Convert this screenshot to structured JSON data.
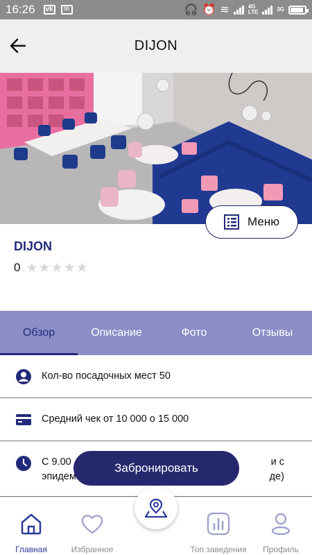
{
  "status_bar": {
    "time": "16:26",
    "network_label_1": "4G",
    "network_label_2": "LTE",
    "network_label_3": "3G"
  },
  "header": {
    "title": "DIJON"
  },
  "hero": {
    "menu_button_label": "Меню"
  },
  "place": {
    "name": "DIJON",
    "rating": "0",
    "stars_filled_fraction": 0
  },
  "tabs": [
    {
      "label": "Обзор",
      "active": true
    },
    {
      "label": "Описание",
      "active": false
    },
    {
      "label": "Фото",
      "active": false
    },
    {
      "label": "Отзывы",
      "active": false
    }
  ],
  "info": {
    "seats": "Кол-во посадочных мест  50",
    "avg_check": "Средний чек от 10 000 о 15 000",
    "hours_line1": "С 9.00",
    "hours_line1_end": "и с",
    "hours_line2": "эпидем",
    "hours_line2_end": "де)"
  },
  "book_button": {
    "label": "Забронировать"
  },
  "bottom_nav": {
    "items": [
      {
        "label": "Главная",
        "icon": "home-icon",
        "active": true
      },
      {
        "label": "Избранное",
        "icon": "heart-icon",
        "active": false
      },
      {
        "label": "Топ заведения",
        "icon": "chart-icon",
        "active": false
      },
      {
        "label": "Профиль",
        "icon": "profile-icon",
        "active": false
      }
    ],
    "map_label": "..."
  },
  "colors": {
    "brand_dark": "#23297a",
    "tab_bar": "#8b8ec6",
    "header_bg": "#efeff1",
    "status_bar": "#8c8c8c",
    "star_inactive": "#d8d8d8"
  }
}
